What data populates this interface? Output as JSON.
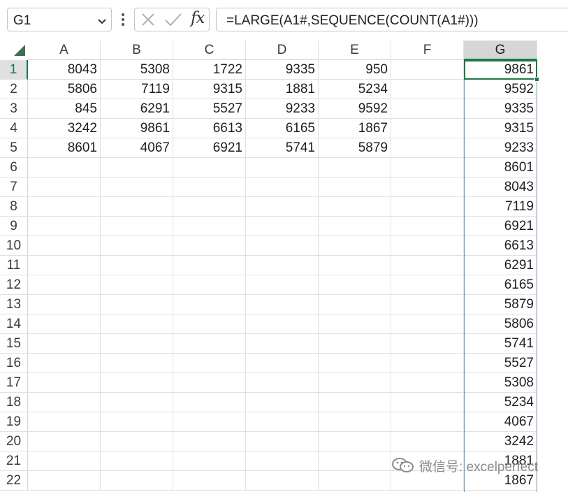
{
  "formula_bar": {
    "name_box": "G1",
    "formula": "=LARGE(A1#,SEQUENCE(COUNT(A1#)))",
    "fx_label": "fx",
    "icons": {
      "name_box_dropdown": "chevron-down-icon",
      "more": "vertical-dots-icon",
      "cancel": "cancel-x-icon",
      "enter": "checkmark-icon"
    }
  },
  "grid": {
    "columns": [
      "A",
      "B",
      "C",
      "D",
      "E",
      "F",
      "G"
    ],
    "selected_column": "G",
    "selected_row": "1",
    "rows": [
      {
        "header": "1",
        "cells": [
          "8043",
          "5308",
          "1722",
          "9335",
          "950",
          "",
          "9861"
        ]
      },
      {
        "header": "2",
        "cells": [
          "5806",
          "7119",
          "9315",
          "1881",
          "5234",
          "",
          "9592"
        ]
      },
      {
        "header": "3",
        "cells": [
          "845",
          "6291",
          "5527",
          "9233",
          "9592",
          "",
          "9335"
        ]
      },
      {
        "header": "4",
        "cells": [
          "3242",
          "9861",
          "6613",
          "6165",
          "1867",
          "",
          "9315"
        ]
      },
      {
        "header": "5",
        "cells": [
          "8601",
          "4067",
          "6921",
          "5741",
          "5879",
          "",
          "9233"
        ]
      },
      {
        "header": "6",
        "cells": [
          "",
          "",
          "",
          "",
          "",
          "",
          "8601"
        ]
      },
      {
        "header": "7",
        "cells": [
          "",
          "",
          "",
          "",
          "",
          "",
          "8043"
        ]
      },
      {
        "header": "8",
        "cells": [
          "",
          "",
          "",
          "",
          "",
          "",
          "7119"
        ]
      },
      {
        "header": "9",
        "cells": [
          "",
          "",
          "",
          "",
          "",
          "",
          "6921"
        ]
      },
      {
        "header": "10",
        "cells": [
          "",
          "",
          "",
          "",
          "",
          "",
          "6613"
        ]
      },
      {
        "header": "11",
        "cells": [
          "",
          "",
          "",
          "",
          "",
          "",
          "6291"
        ]
      },
      {
        "header": "12",
        "cells": [
          "",
          "",
          "",
          "",
          "",
          "",
          "6165"
        ]
      },
      {
        "header": "13",
        "cells": [
          "",
          "",
          "",
          "",
          "",
          "",
          "5879"
        ]
      },
      {
        "header": "14",
        "cells": [
          "",
          "",
          "",
          "",
          "",
          "",
          "5806"
        ]
      },
      {
        "header": "15",
        "cells": [
          "",
          "",
          "",
          "",
          "",
          "",
          "5741"
        ]
      },
      {
        "header": "16",
        "cells": [
          "",
          "",
          "",
          "",
          "",
          "",
          "5527"
        ]
      },
      {
        "header": "17",
        "cells": [
          "",
          "",
          "",
          "",
          "",
          "",
          "5308"
        ]
      },
      {
        "header": "18",
        "cells": [
          "",
          "",
          "",
          "",
          "",
          "",
          "5234"
        ]
      },
      {
        "header": "19",
        "cells": [
          "",
          "",
          "",
          "",
          "",
          "",
          "4067"
        ]
      },
      {
        "header": "20",
        "cells": [
          "",
          "",
          "",
          "",
          "",
          "",
          "3242"
        ]
      },
      {
        "header": "21",
        "cells": [
          "",
          "",
          "",
          "",
          "",
          "",
          "1881"
        ]
      },
      {
        "header": "22",
        "cells": [
          "",
          "",
          "",
          "",
          "",
          "",
          "1867"
        ]
      }
    ]
  },
  "watermark": {
    "text": "微信号: excelperfect",
    "icon": "wechat-icon"
  },
  "colors": {
    "accent": "#1a7a45",
    "spill_border": "#6d8fb5",
    "selected_header": "#d6d6d6"
  }
}
